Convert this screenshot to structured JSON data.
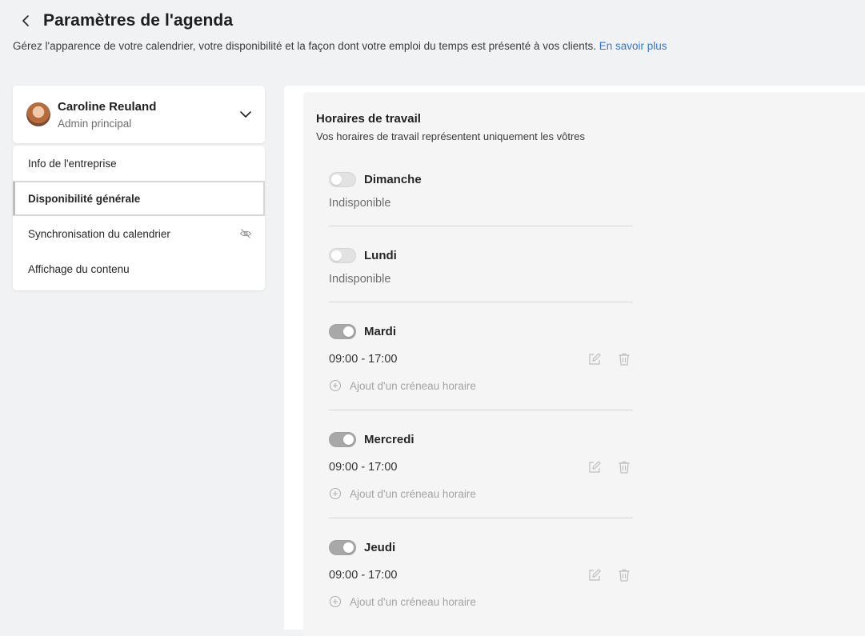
{
  "header": {
    "title": "Paramètres de l'agenda",
    "subtitle": "Gérez l'apparence de votre calendrier, votre disponibilité et la façon dont votre emploi du temps est présenté à vos clients.",
    "learn_more": "En savoir plus"
  },
  "profile": {
    "name": "Caroline Reuland",
    "role": "Admin principal"
  },
  "menu": {
    "items": [
      {
        "label": "Info de l'entreprise"
      },
      {
        "label": "Disponibilité générale"
      },
      {
        "label": "Synchronisation du calendrier"
      },
      {
        "label": "Affichage du contenu"
      }
    ]
  },
  "working_hours": {
    "title": "Horaires de travail",
    "subtitle": "Vos horaires de travail représentent uniquement les vôtres",
    "add_slot_label": "Ajout d'un créneau horaire",
    "days": [
      {
        "name": "Dimanche",
        "status": "Indisponible"
      },
      {
        "name": "Lundi",
        "status": "Indisponible"
      },
      {
        "name": "Mardi",
        "slot": "09:00 - 17:00"
      },
      {
        "name": "Mercredi",
        "slot": "09:00 - 17:00"
      },
      {
        "name": "Jeudi",
        "slot": "09:00 - 17:00"
      }
    ]
  },
  "colors": {
    "accent_link": "#2f78d6",
    "toggle_on": "#a8a8a8",
    "toggle_off": "#e2e2e2"
  }
}
